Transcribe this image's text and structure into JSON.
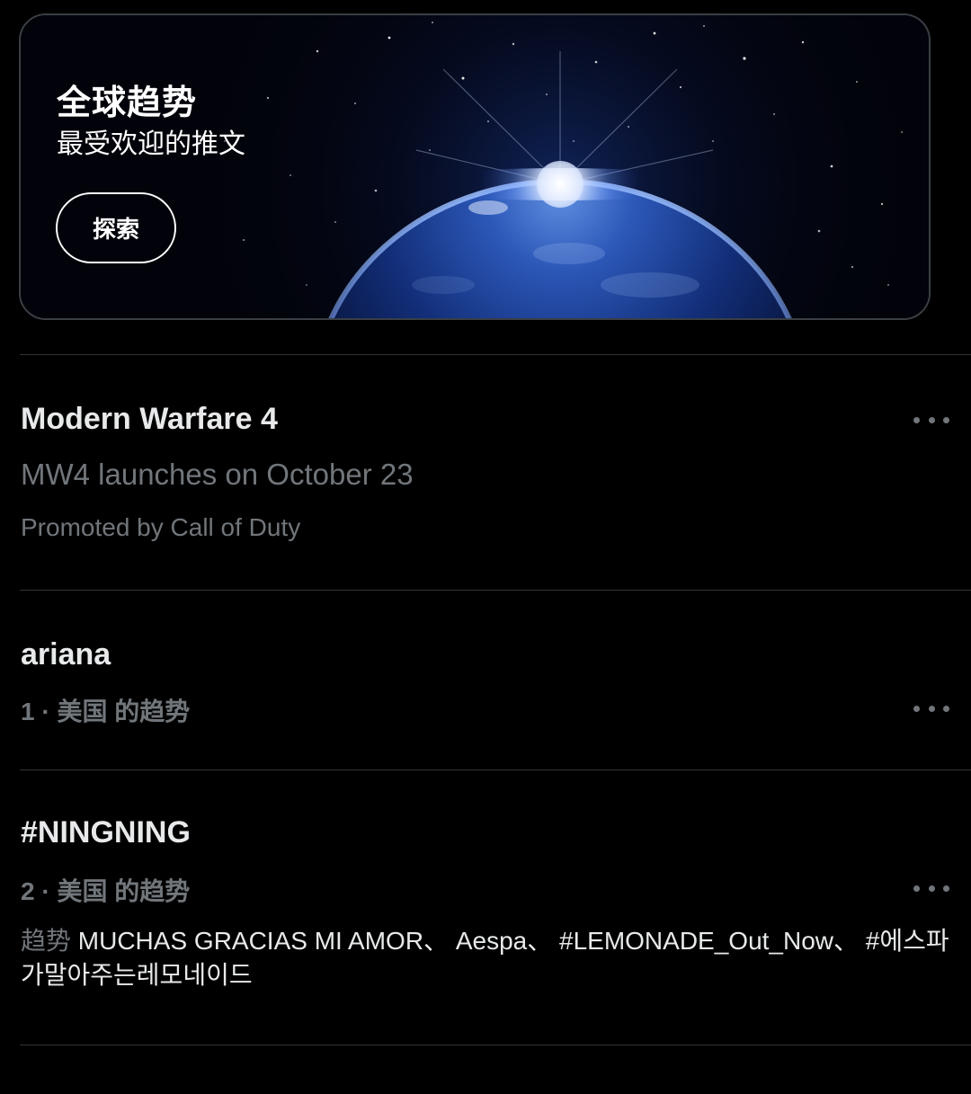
{
  "banner": {
    "title": "全球趋势",
    "subtitle": "最受欢迎的推文",
    "button_label": "探索"
  },
  "trends": [
    {
      "title": "Modern Warfare 4",
      "subtitle": "MW4 launches on October 23",
      "meta": "Promoted by Call of Duty",
      "more_icon": "more-horizontal-icon"
    },
    {
      "title": "ariana",
      "meta": "1 · 美国 的趋势",
      "more_icon": "more-horizontal-icon"
    },
    {
      "title": "#NINGNING",
      "meta": "2 · 美国 的趋势",
      "related_label": "趋势",
      "related_text": " MUCHAS GRACIAS MI AMOR、 Aespa、 #LEMONADE_Out_Now、 #에스파가말아주는레모네이드",
      "more_icon": "more-horizontal-icon"
    }
  ],
  "colors": {
    "background": "#000000",
    "primary_text": "#e7e9ea",
    "secondary_text": "#71767b",
    "divider": "#2f3336",
    "card_border": "#3a3f44"
  }
}
